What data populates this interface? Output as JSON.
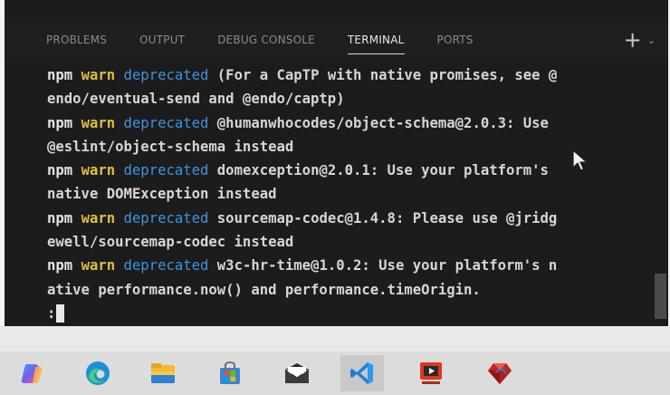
{
  "panel": {
    "tabs": [
      {
        "label": "PROBLEMS"
      },
      {
        "label": "OUTPUT"
      },
      {
        "label": "DEBUG CONSOLE"
      },
      {
        "label": "TERMINAL"
      },
      {
        "label": "PORTS"
      }
    ],
    "active_tab": "TERMINAL",
    "add_label": "+",
    "dropdown_label": "⌄",
    "more_label": "⋯"
  },
  "terminal": {
    "lines": [
      {
        "npm": "npm",
        "warn": "warn",
        "dep": "deprecated",
        "text": " (For a CapTP with native promises, see @"
      },
      {
        "text": "endo/eventual-send and @endo/captp)"
      },
      {
        "npm": "npm",
        "warn": "warn",
        "dep": "deprecated",
        "text": " @humanwhocodes/object-schema@2.0.3: Use"
      },
      {
        "text": "@eslint/object-schema instead"
      },
      {
        "npm": "npm",
        "warn": "warn",
        "dep": "deprecated",
        "text": " domexception@2.0.1: Use your platform's"
      },
      {
        "text": "native DOMException instead"
      },
      {
        "npm": "npm",
        "warn": "warn",
        "dep": "deprecated",
        "text": " sourcemap-codec@1.4.8: Please use @jridg"
      },
      {
        "text": "ewell/sourcemap-codec instead"
      },
      {
        "npm": "npm",
        "warn": "warn",
        "dep": "deprecated",
        "text": " w3c-hr-time@1.0.2: Use your platform's n"
      },
      {
        "text": "ative performance.now() and performance.timeOrigin."
      }
    ],
    "prompt": ":"
  },
  "colors": {
    "terminal_bg": "#1c1c1c",
    "warn": "#e1bf3a",
    "deprecated": "#3a95e0",
    "text": "#d6d6d6"
  },
  "taskbar": {
    "items": [
      {
        "icon": "copilot-icon"
      },
      {
        "icon": "edge-icon"
      },
      {
        "icon": "file-explorer-icon"
      },
      {
        "icon": "microsoft-store-icon"
      },
      {
        "icon": "mail-icon"
      },
      {
        "icon": "vscode-icon",
        "active": true
      },
      {
        "icon": "media-app-icon"
      },
      {
        "icon": "ruby-icon"
      }
    ]
  }
}
